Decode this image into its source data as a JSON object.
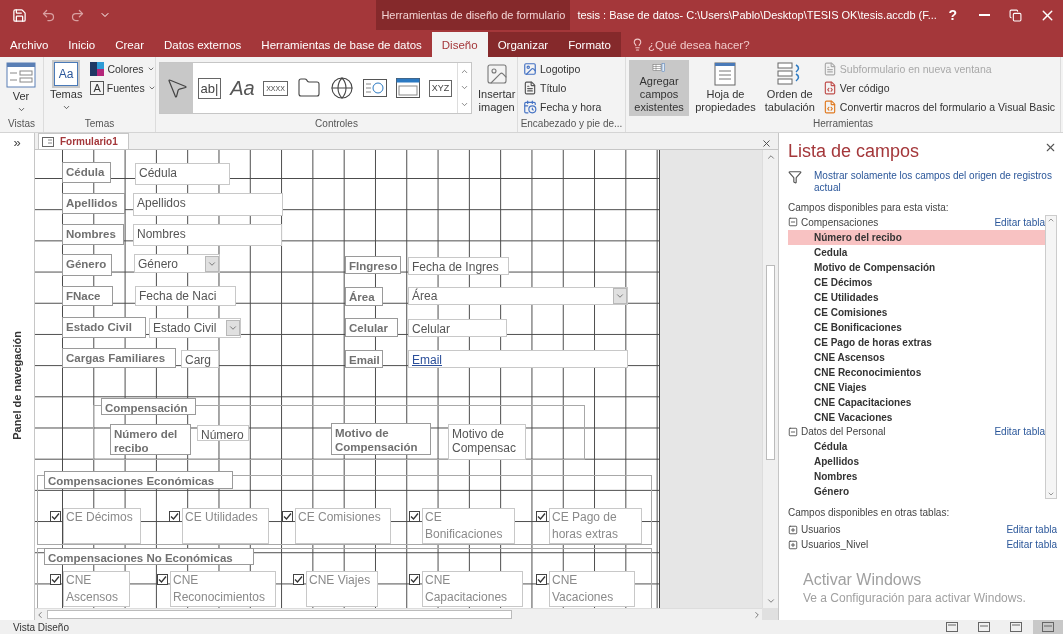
{
  "title_bar": {
    "contextual_label": "Herramientas de diseño de formulario",
    "title": "tesis : Base de datos- C:\\Users\\Pablo\\Desktop\\TESIS OK\\tesis.accdb (F...",
    "help": "?"
  },
  "tabs": [
    {
      "label": "Archivo",
      "selected": false,
      "contextual": false
    },
    {
      "label": "Inicio",
      "selected": false,
      "contextual": false
    },
    {
      "label": "Crear",
      "selected": false,
      "contextual": false
    },
    {
      "label": "Datos externos",
      "selected": false,
      "contextual": false
    },
    {
      "label": "Herramientas de base de datos",
      "selected": false,
      "contextual": false
    },
    {
      "label": "Diseño",
      "selected": true,
      "contextual": true
    },
    {
      "label": "Organizar",
      "selected": false,
      "contextual": true
    },
    {
      "label": "Formato",
      "selected": false,
      "contextual": true
    }
  ],
  "tell_me": "¿Qué desea hacer?",
  "ribbon": {
    "vistas": {
      "label": "Vistas",
      "view": "Ver"
    },
    "temas": {
      "label": "Temas",
      "themes": "Temas",
      "themes_glyph": "Aa",
      "colors": "Colores",
      "fonts": "Fuentes",
      "fonts_glyph": "A"
    },
    "controles": {
      "label": "Controles",
      "tools": [
        {
          "kind": "pointer",
          "selected": true
        },
        {
          "kind": "textbox",
          "glyph": "ab|",
          "selected": false
        },
        {
          "kind": "label",
          "glyph": "Aa",
          "selected": false
        },
        {
          "kind": "button",
          "glyph": "XXXX",
          "selected": false
        },
        {
          "kind": "tab",
          "selected": false
        },
        {
          "kind": "hyperlink",
          "selected": false
        },
        {
          "kind": "browser",
          "selected": false
        },
        {
          "kind": "navigation",
          "selected": false
        },
        {
          "kind": "group",
          "glyph": "XYZ",
          "selected": false
        }
      ],
      "insert_image": "Insertar\nimagen"
    },
    "encabezado": {
      "label": "Encabezado y pie de...",
      "items": [
        "Logotipo",
        "Título",
        "Fecha y hora"
      ]
    },
    "herramientas": {
      "label": "Herramientas",
      "add_fields": {
        "label": "Agregar campos\nexistentes",
        "selected": true
      },
      "property_sheet": "Hoja de\npropiedades",
      "tab_order": "Orden de\ntabulación",
      "small": [
        {
          "label": "Subformulario en nueva ventana",
          "disabled": true
        },
        {
          "label": "Ver código",
          "disabled": false
        },
        {
          "label": "Convertir macros del formulario a Visual Basic",
          "disabled": false
        }
      ]
    }
  },
  "nav_pane": {
    "toggle": "»",
    "label": "Panel de navegación"
  },
  "document": {
    "tab": "Formulario1",
    "controls": [
      {
        "kind": "label",
        "text": "Cédula"
      },
      {
        "kind": "textbox",
        "text": "Cédula"
      },
      {
        "kind": "label",
        "text": "Apellidos"
      },
      {
        "kind": "textbox",
        "text": "Apellidos"
      },
      {
        "kind": "label",
        "text": "Nombres"
      },
      {
        "kind": "textbox",
        "text": "Nombres"
      },
      {
        "kind": "label",
        "text": "Género"
      },
      {
        "kind": "combo",
        "text": "Género"
      },
      {
        "kind": "label",
        "text": "FIngreso"
      },
      {
        "kind": "textbox",
        "text": "Fecha de Ingres"
      },
      {
        "kind": "label",
        "text": "FNace"
      },
      {
        "kind": "textbox",
        "text": "Fecha de Naci"
      },
      {
        "kind": "label",
        "text": "Área"
      },
      {
        "kind": "combo",
        "text": "Área"
      },
      {
        "kind": "label",
        "text": "Estado Civil"
      },
      {
        "kind": "combo",
        "text": "Estado Civil"
      },
      {
        "kind": "label",
        "text": "Celular"
      },
      {
        "kind": "textbox",
        "text": "Celular"
      },
      {
        "kind": "label",
        "text": "Cargas Familiares"
      },
      {
        "kind": "textbox",
        "text": "Carg"
      },
      {
        "kind": "label",
        "text": "Email"
      },
      {
        "kind": "link",
        "text": "Email"
      },
      {
        "kind": "label",
        "text": "Compensación"
      },
      {
        "kind": "label",
        "text": "Número del recibo"
      },
      {
        "kind": "textbox",
        "text": "Número"
      },
      {
        "kind": "label",
        "text": "Motivo de Compensación"
      },
      {
        "kind": "textbox",
        "text": "Motivo de Compensac"
      },
      {
        "kind": "label",
        "text": "Compensaciones Económicas"
      },
      {
        "kind": "checkbox",
        "text": "CE Décimos",
        "checked": true
      },
      {
        "kind": "checkbox",
        "text": "CE Utilidades",
        "checked": true
      },
      {
        "kind": "checkbox",
        "text": "CE Comisiones",
        "checked": true
      },
      {
        "kind": "checkbox",
        "text": "CE Bonificaciones",
        "checked": true
      },
      {
        "kind": "checkbox",
        "text": "CE Pago de horas extras",
        "checked": true
      },
      {
        "kind": "label",
        "text": "Compensaciones No Económicas"
      },
      {
        "kind": "checkbox",
        "text": "CNE Ascensos",
        "checked": true
      },
      {
        "kind": "checkbox",
        "text": "CNE Reconocimientos",
        "checked": true
      },
      {
        "kind": "checkbox",
        "text": "CNE Viajes",
        "checked": true
      },
      {
        "kind": "checkbox",
        "text": "CNE Capacitaciones",
        "checked": true
      },
      {
        "kind": "checkbox",
        "text": "CNE Vacaciones",
        "checked": true
      }
    ]
  },
  "field_list": {
    "title": "Lista de campos",
    "show_only": "Mostrar solamente los campos del origen de registros actual",
    "available_label": "Campos disponibles para esta vista:",
    "tables": [
      {
        "label": "Compensaciones",
        "expanded": true,
        "action": "Editar tabla",
        "children": [
          {
            "label": "Número del recibo",
            "selected": true
          },
          {
            "label": "Cedula",
            "selected": false
          },
          {
            "label": "Motivo de Compensación",
            "selected": false
          },
          {
            "label": "CE Décimos",
            "selected": false
          },
          {
            "label": "CE Utilidades",
            "selected": false
          },
          {
            "label": "CE Comisiones",
            "selected": false
          },
          {
            "label": "CE Bonificaciones",
            "selected": false
          },
          {
            "label": "CE Pago de horas extras",
            "selected": false
          },
          {
            "label": "CNE Ascensos",
            "selected": false
          },
          {
            "label": "CNE Reconocimientos",
            "selected": false
          },
          {
            "label": "CNE Viajes",
            "selected": false
          },
          {
            "label": "CNE Capacitaciones",
            "selected": false
          },
          {
            "label": "CNE Vacaciones",
            "selected": false
          }
        ]
      },
      {
        "label": "Datos del Personal",
        "expanded": true,
        "action": "Editar tabla",
        "children": [
          {
            "label": "Cédula",
            "selected": false
          },
          {
            "label": "Apellidos",
            "selected": false
          },
          {
            "label": "Nombres",
            "selected": false
          },
          {
            "label": "Género",
            "selected": false
          }
        ]
      }
    ],
    "other_label": "Campos disponibles en otras tablas:",
    "other_tables": [
      {
        "label": "Usuarios",
        "expanded": false,
        "action": "Editar tabla"
      },
      {
        "label": "Usuarios_Nivel",
        "expanded": false,
        "action": "Editar tabla"
      }
    ]
  },
  "activation": {
    "title": "Activar Windows",
    "text": "Ve a Configuración para activar Windows."
  },
  "status_bar": {
    "text": "Vista Diseño",
    "views": [
      {
        "selected": false
      },
      {
        "selected": false
      },
      {
        "selected": false
      },
      {
        "selected": true
      }
    ]
  }
}
